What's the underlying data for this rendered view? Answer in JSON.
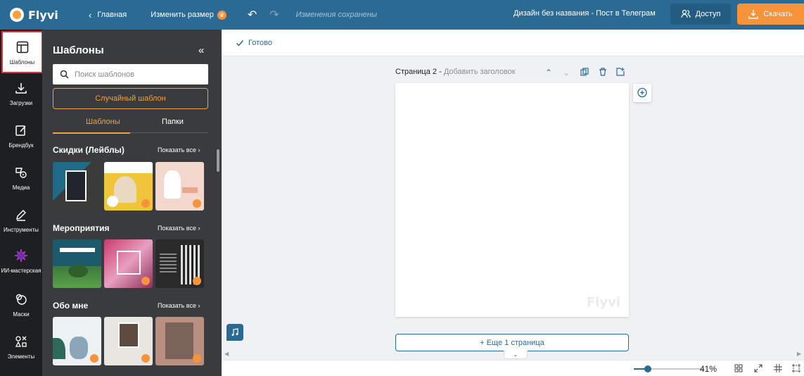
{
  "header": {
    "logo": "Flyvi",
    "home": "Главная",
    "resize": "Изменить размер",
    "saved_status": "Изменения сохранены",
    "document_title": "Дизайн без названия - Пост в Телеграм ...",
    "access_button": "Доступ",
    "download_button": "Скачать"
  },
  "rail": {
    "items": [
      {
        "label": "Шаблоны",
        "icon": "layout-icon",
        "active": true
      },
      {
        "label": "Загрузки",
        "icon": "upload-icon"
      },
      {
        "label": "Брендбук",
        "icon": "brandbook-icon"
      },
      {
        "label": "Медиа",
        "icon": "media-icon"
      },
      {
        "label": "Инструменты",
        "icon": "pen-icon"
      },
      {
        "label": "ИИ-мастерская",
        "icon": "ai-icon"
      },
      {
        "label": "Маски",
        "icon": "mask-icon"
      },
      {
        "label": "Элементы",
        "icon": "shapes-icon"
      }
    ]
  },
  "panel": {
    "title": "Шаблоны",
    "search_placeholder": "Поиск шаблонов",
    "random_button": "Случайный шаблон",
    "tabs": [
      "Шаблоны",
      "Папки"
    ],
    "show_all": "Показать все",
    "sections": [
      {
        "title": "Скидки (Лейблы)"
      },
      {
        "title": "Мероприятия"
      },
      {
        "title": "Обо мне"
      }
    ]
  },
  "toolbar": {
    "done": "Готово"
  },
  "page": {
    "label": "Страница 2 -",
    "add_title": "Добавить заголовок",
    "watermark": "Flyvi",
    "more_pages": "+ Еще 1 страница"
  },
  "zoom": {
    "value": "41%",
    "fraction": 0.2
  },
  "colors": {
    "header": "#2b6a92",
    "accent": "#f7933a",
    "rail": "#1e1f22",
    "panel": "#3a3b3e"
  }
}
